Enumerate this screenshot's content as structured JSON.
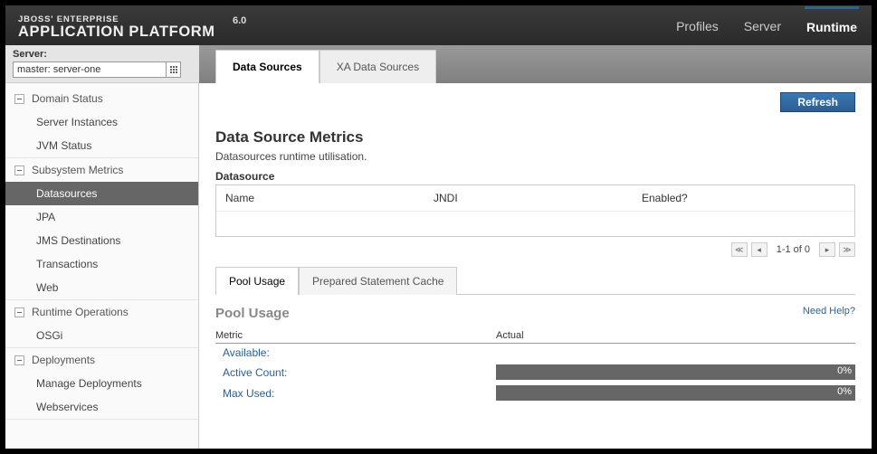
{
  "brand": {
    "line1": "JBOSS' ENTERPRISE",
    "line2": "APPLICATION PLATFORM",
    "version": "6.0"
  },
  "topnav": {
    "profiles": "Profiles",
    "server": "Server",
    "runtime": "Runtime"
  },
  "server_select": {
    "label": "Server:",
    "value": "master: server-one"
  },
  "subtabs": {
    "ds": "Data Sources",
    "xa": "XA Data Sources"
  },
  "sidebar": {
    "domain_status": {
      "label": "Domain Status",
      "items": {
        "server_instances": "Server Instances",
        "jvm_status": "JVM Status"
      }
    },
    "subsystem_metrics": {
      "label": "Subsystem Metrics",
      "items": {
        "datasources": "Datasources",
        "jpa": "JPA",
        "jms": "JMS Destinations",
        "tx": "Transactions",
        "web": "Web"
      }
    },
    "runtime_ops": {
      "label": "Runtime Operations",
      "items": {
        "osgi": "OSGi"
      }
    },
    "deployments": {
      "label": "Deployments",
      "items": {
        "manage": "Manage Deployments",
        "ws": "Webservices"
      }
    }
  },
  "content": {
    "refresh": "Refresh",
    "title": "Data Source Metrics",
    "desc": "Datasources runtime utilisation.",
    "ds_label": "Datasource",
    "cols": {
      "name": "Name",
      "jndi": "JNDI",
      "enabled": "Enabled?"
    },
    "pager": "1-1 of 0",
    "inner_tabs": {
      "pool": "Pool Usage",
      "psc": "Prepared Statement Cache"
    },
    "pool_title": "Pool Usage",
    "help": "Need Help?",
    "metric_hd": {
      "metric": "Metric",
      "actual": "Actual"
    },
    "metrics": {
      "available": {
        "label": "Available:"
      },
      "active": {
        "label": "Active Count:",
        "pct": "0%"
      },
      "max": {
        "label": "Max Used:",
        "pct": "0%"
      }
    }
  }
}
